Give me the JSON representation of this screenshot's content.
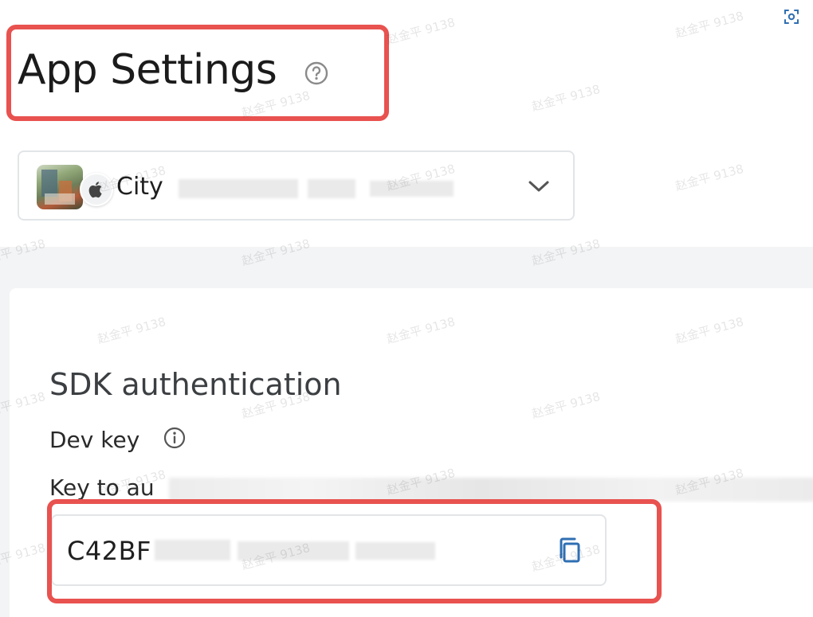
{
  "header": {
    "title": "App Settings",
    "help_icon": "help-circle-icon",
    "focus_icon": "scan-focus-icon"
  },
  "app_selector": {
    "app_name_visible": "City",
    "platform_icon": "apple-icon",
    "chevron_icon": "chevron-down-icon"
  },
  "sdk_section": {
    "title": "SDK authentication",
    "dev_key_label": "Dev key",
    "dev_key_desc_visible": "Key to au",
    "dev_key_value_visible": "C42BF",
    "info_icon": "info-icon",
    "copy_icon": "copy-icon"
  },
  "watermark_text": "赵金平 9138",
  "colors": {
    "highlight": "#e8524f",
    "accent": "#2f6fb3",
    "content_bg": "#f3f4f5"
  }
}
